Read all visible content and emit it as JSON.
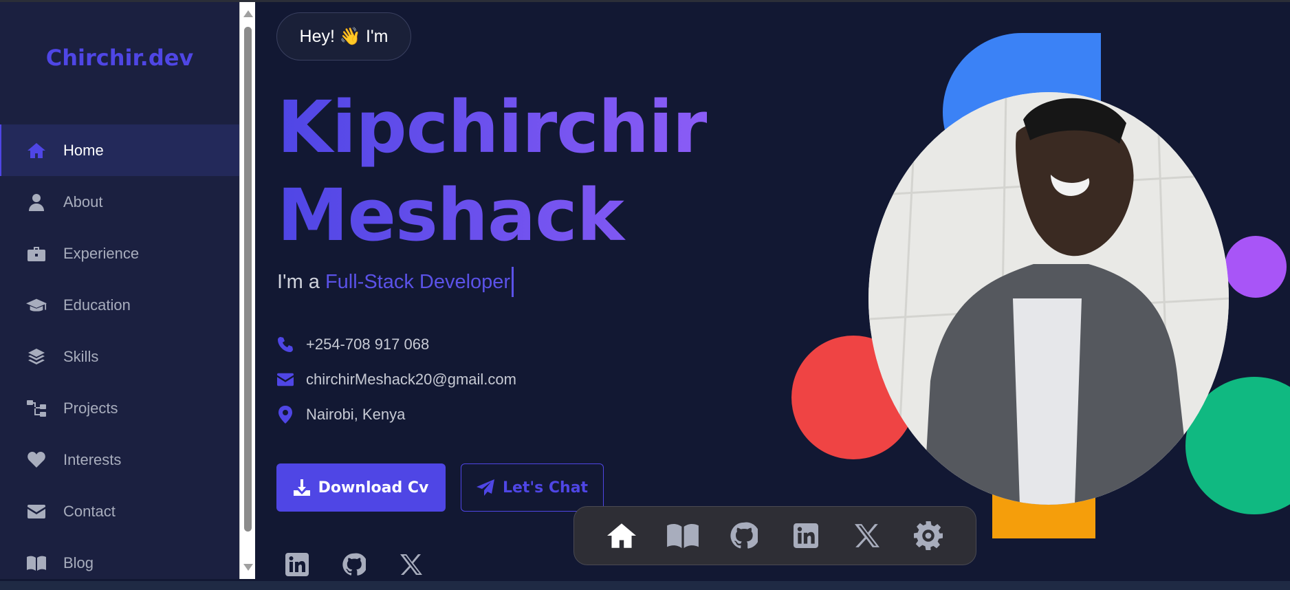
{
  "sidebar": {
    "brand": "Chirchir.dev",
    "items": [
      {
        "label": "Home",
        "icon": "home-icon",
        "active": true
      },
      {
        "label": "About",
        "icon": "user-icon"
      },
      {
        "label": "Experience",
        "icon": "briefcase-icon"
      },
      {
        "label": "Education",
        "icon": "graduation-cap-icon"
      },
      {
        "label": "Skills",
        "icon": "layers-icon"
      },
      {
        "label": "Projects",
        "icon": "sitemap-icon"
      },
      {
        "label": "Interests",
        "icon": "heart-icon"
      },
      {
        "label": "Contact",
        "icon": "envelope-icon"
      },
      {
        "label": "Blog",
        "icon": "book-icon"
      }
    ]
  },
  "hero": {
    "greeting": "Hey! 👋 I'm",
    "name_line1": "Kipchirchir",
    "name_line2": "Meshack",
    "role_prefix": "I'm a",
    "role_highlight": "Full-Stack Developer",
    "phone": "+254-708 917 068",
    "email": "chirchirMeshack20@gmail.com",
    "location": "Nairobi, Kenya",
    "download_label": "Download Cv",
    "chat_label": "Let's Chat"
  },
  "social": [
    "linkedin-icon",
    "github-icon",
    "x-icon"
  ],
  "dock": [
    "home-icon",
    "book-icon",
    "github-icon",
    "linkedin-icon",
    "x-icon",
    "gear-icon"
  ],
  "colors": {
    "accent": "#4f46e5",
    "accent_purple": "#8b5cf6",
    "background": "#121833",
    "sidebar": "#1b2040",
    "blob_blue": "#3b82f6",
    "blob_purple": "#a855f7",
    "blob_red": "#ef4444",
    "blob_green": "#10b981",
    "blob_amber": "#f59e0b"
  }
}
